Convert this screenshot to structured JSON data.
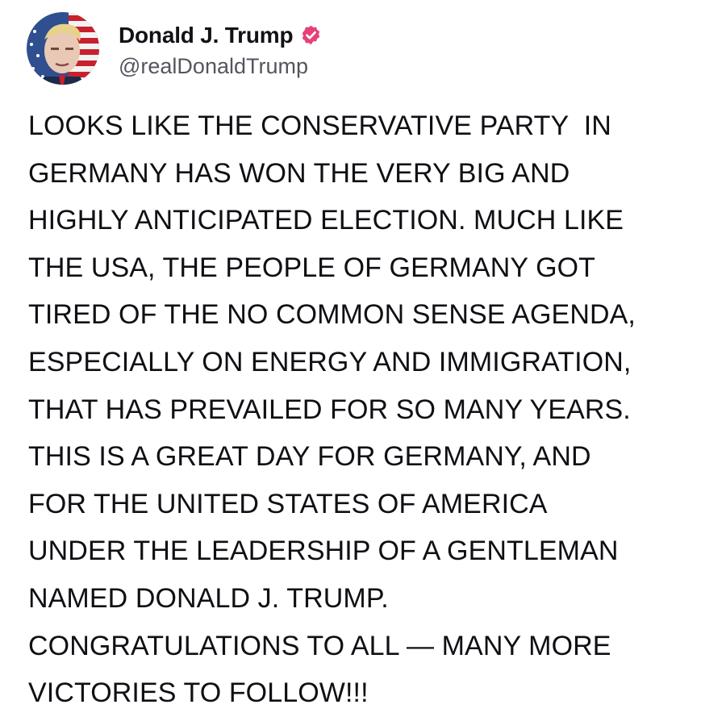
{
  "author": {
    "display_name": "Donald J. Trump",
    "handle": "@realDonaldTrump",
    "verified": true,
    "avatar_icon": "profile-avatar-flag-portrait",
    "badge_icon": "verified-badge-icon"
  },
  "post": {
    "lines": [
      "LOOKS LIKE THE CONSERVATIVE PARTY  IN",
      "GERMANY HAS WON THE VERY BIG AND",
      "HIGHLY ANTICIPATED ELECTION. MUCH LIKE",
      "THE USA, THE PEOPLE OF GERMANY GOT",
      "TIRED OF THE NO COMMON SENSE AGENDA,",
      "ESPECIALLY ON ENERGY AND IMMIGRATION,",
      "THAT HAS PREVAILED FOR SO MANY YEARS.",
      "THIS IS A GREAT DAY FOR GERMANY, AND",
      "FOR THE UNITED STATES OF AMERICA",
      "UNDER THE LEADERSHIP OF A GENTLEMAN",
      "NAMED DONALD J. TRUMP.",
      "CONGRATULATIONS TO ALL — MANY MORE",
      "VICTORIES TO FOLLOW!!!"
    ]
  },
  "colors": {
    "badge": "#e6427a",
    "text": "#0f0f14",
    "handle": "#55555e",
    "background": "#ffffff"
  }
}
